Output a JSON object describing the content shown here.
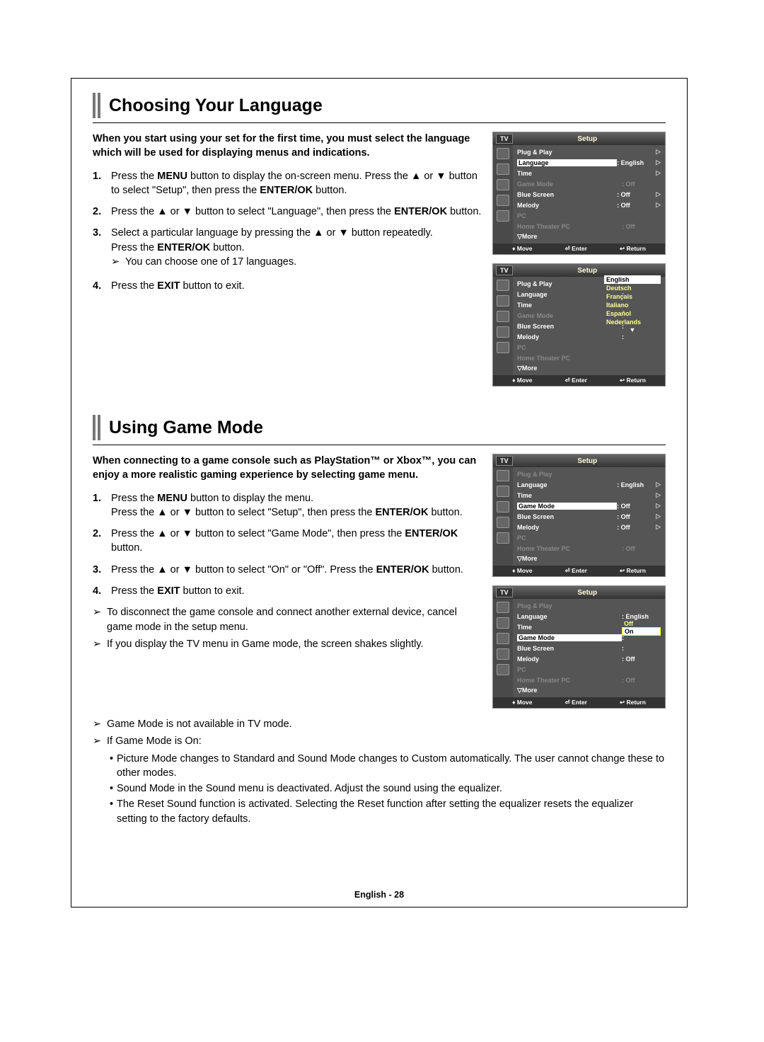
{
  "section1": {
    "title": "Choosing Your Language",
    "intro": "When you start using your set for the first time, you must select the language which will be used for displaying menus and indications.",
    "steps": [
      {
        "num": "1.",
        "html": "Press the <b>MENU</b> button to display the on-screen menu. Press the ▲ or ▼ button to select \"Setup\", then press the <b>ENTER/OK</b> button."
      },
      {
        "num": "2.",
        "html": "Press the ▲ or ▼ button to select \"Language\", then press the <b>ENTER/OK</b> button."
      },
      {
        "num": "3.",
        "html": "Select a particular language by pressing the ▲ or ▼ button repeatedly.<br>Press the <b>ENTER/OK</b> button.",
        "arrow": "You can choose one of 17 languages."
      },
      {
        "num": "4.",
        "html": "Press the <b>EXIT</b> button to exit."
      }
    ],
    "osd1": {
      "tv": "TV",
      "setup": "Setup",
      "rows": [
        {
          "lab": "Plug & Play",
          "val": "",
          "tri": "▷"
        },
        {
          "lab": "Language",
          "val": ": English",
          "tri": "▷",
          "hl": true
        },
        {
          "lab": "Time",
          "val": "",
          "tri": "▷"
        },
        {
          "lab": "Game Mode",
          "val": ": Off",
          "tri": "",
          "dim": true
        },
        {
          "lab": "Blue Screen",
          "val": ": Off",
          "tri": "▷"
        },
        {
          "lab": "Melody",
          "val": ": Off",
          "tri": "▷"
        },
        {
          "lab": "PC",
          "val": "",
          "tri": "",
          "dim": true
        },
        {
          "lab": "Home Theater PC",
          "val": ": Off",
          "tri": "",
          "dim": true
        },
        {
          "lab": "▽More",
          "val": "",
          "tri": ""
        }
      ],
      "foot": {
        "move": "Move",
        "enter": "Enter",
        "ret": "Return"
      }
    },
    "osd2": {
      "tv": "TV",
      "setup": "Setup",
      "rows": [
        {
          "lab": "Plug & Play",
          "val": "",
          "tri": ""
        },
        {
          "lab": "Language",
          "val": ":",
          "tri": ""
        },
        {
          "lab": "Time",
          "val": "",
          "tri": ""
        },
        {
          "lab": "Game Mode",
          "val": ":",
          "tri": "",
          "dim": true
        },
        {
          "lab": "Blue Screen",
          "val": ":",
          "tri": ""
        },
        {
          "lab": "Melody",
          "val": ":",
          "tri": ""
        },
        {
          "lab": "PC",
          "val": "",
          "tri": "",
          "dim": true
        },
        {
          "lab": "Home Theater PC",
          "val": "",
          "tri": "",
          "dim": true
        },
        {
          "lab": "▽More",
          "val": "",
          "tri": ""
        }
      ],
      "langs": [
        "English",
        "Deutsch",
        "Français",
        "Italiano",
        "Español",
        "Nederlands"
      ],
      "foot": {
        "move": "Move",
        "enter": "Enter",
        "ret": "Return"
      }
    }
  },
  "section2": {
    "title": "Using Game Mode",
    "intro": "When connecting to a game console such as PlayStation™ or Xbox™, you can enjoy a more realistic gaming experience by selecting game menu.",
    "steps": [
      {
        "num": "1.",
        "html": "Press the <b>MENU</b> button to display the menu.<br>Press the ▲ or ▼ button to select \"Setup\", then press the <b>ENTER/OK</b> button."
      },
      {
        "num": "2.",
        "html": "Press the ▲ or ▼ button to select \"Game Mode\", then press the <b>ENTER/OK</b> button."
      },
      {
        "num": "3.",
        "html": "Press the ▲ or ▼ button to select \"On\" or \"Off\". Press the <b>ENTER/OK</b> button."
      },
      {
        "num": "4.",
        "html": "Press the <b>EXIT</b> button to exit."
      }
    ],
    "arrows": [
      "To disconnect the game console and connect another external device, cancel game mode in the setup menu.",
      "If you display the TV menu in Game mode, the screen shakes slightly.",
      "Game Mode is not available in TV mode.",
      "If Game Mode is On:"
    ],
    "bullets": [
      "Picture Mode changes to Standard and Sound Mode changes to Custom automatically. The user cannot change these to other modes.",
      "Sound Mode in the Sound menu is deactivated. Adjust the sound using the equalizer.",
      "The Reset Sound function is activated. Selecting the Reset function after setting the equalizer resets the equalizer setting to the factory defaults."
    ],
    "osd1": {
      "tv": "TV",
      "setup": "Setup",
      "rows": [
        {
          "lab": "Plug & Play",
          "val": "",
          "tri": "",
          "dim": true
        },
        {
          "lab": "Language",
          "val": ": English",
          "tri": "▷"
        },
        {
          "lab": "Time",
          "val": "",
          "tri": "▷"
        },
        {
          "lab": "Game Mode",
          "val": ": Off",
          "tri": "▷",
          "hl": true
        },
        {
          "lab": "Blue Screen",
          "val": ": Off",
          "tri": "▷"
        },
        {
          "lab": "Melody",
          "val": ": Off",
          "tri": "▷"
        },
        {
          "lab": "PC",
          "val": "",
          "tri": "",
          "dim": true
        },
        {
          "lab": "Home Theater PC",
          "val": ": Off",
          "tri": "",
          "dim": true
        },
        {
          "lab": "▽More",
          "val": "",
          "tri": ""
        }
      ],
      "foot": {
        "move": "Move",
        "enter": "Enter",
        "ret": "Return"
      }
    },
    "osd2": {
      "tv": "TV",
      "setup": "Setup",
      "rows": [
        {
          "lab": "Plug & Play",
          "val": "",
          "tri": "",
          "dim": true
        },
        {
          "lab": "Language",
          "val": ": English",
          "tri": ""
        },
        {
          "lab": "Time",
          "val": "",
          "tri": ""
        },
        {
          "lab": "Game Mode",
          "val": ":",
          "tri": "",
          "hl": true
        },
        {
          "lab": "Blue Screen",
          "val": ":",
          "tri": ""
        },
        {
          "lab": "Melody",
          "val": ": Off",
          "tri": ""
        },
        {
          "lab": "PC",
          "val": "",
          "tri": "",
          "dim": true
        },
        {
          "lab": "Home Theater PC",
          "val": ": Off",
          "tri": "",
          "dim": true
        },
        {
          "lab": "▽More",
          "val": "",
          "tri": ""
        }
      ],
      "gmopts": [
        "Off",
        "On"
      ],
      "foot": {
        "move": "Move",
        "enter": "Enter",
        "ret": "Return"
      }
    }
  },
  "footer": "English - 28"
}
